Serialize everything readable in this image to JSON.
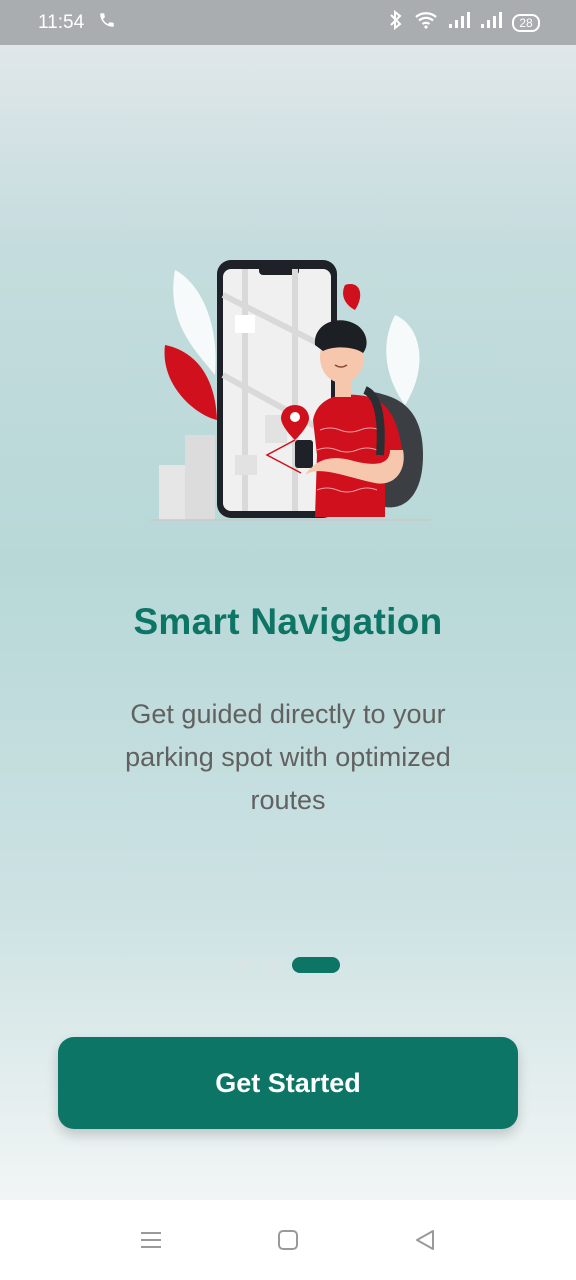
{
  "status_bar": {
    "time": "11:54",
    "battery": "28",
    "icons": [
      "phone-call-icon",
      "bluetooth-icon",
      "wifi-icon",
      "signal-icon",
      "signal-icon",
      "battery-icon"
    ]
  },
  "onboarding": {
    "title": "Smart Navigation",
    "description": "Get guided directly to your parking spot with optimized routes",
    "page_count": 3,
    "active_page": 3
  },
  "cta": {
    "label": "Get Started"
  },
  "nav_bar": {
    "icons": [
      "menu-icon",
      "home-icon",
      "back-icon"
    ]
  },
  "colors": {
    "accent": "#0d7565",
    "text_muted": "#616161",
    "illustration_red": "#d0101c"
  }
}
